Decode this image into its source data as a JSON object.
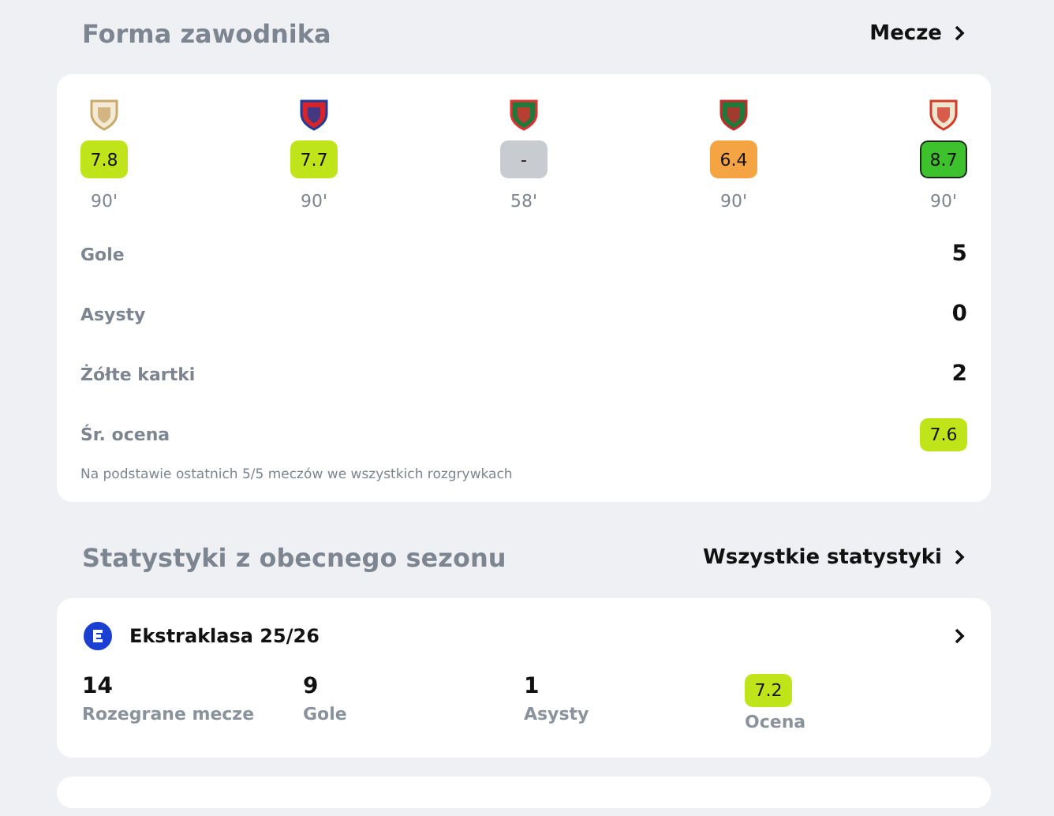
{
  "form_section": {
    "title": "Forma zawodnika",
    "link": "Mecze"
  },
  "matches": [
    {
      "rating": "7.8",
      "color": "#c0e41a",
      "highlighted": false,
      "minutes": "90'"
    },
    {
      "rating": "7.7",
      "color": "#c0e41a",
      "highlighted": false,
      "minutes": "90'"
    },
    {
      "rating": "-",
      "color": "#c8cbcf",
      "highlighted": false,
      "minutes": "58'"
    },
    {
      "rating": "6.4",
      "color": "#f4a443",
      "highlighted": false,
      "minutes": "90'"
    },
    {
      "rating": "8.7",
      "color": "#3dc12c",
      "highlighted": true,
      "minutes": "90'"
    }
  ],
  "form_stats": [
    {
      "kind": "number",
      "label": "Gole",
      "value": "5"
    },
    {
      "kind": "number",
      "label": "Asysty",
      "value": "0"
    },
    {
      "kind": "number",
      "label": "Żółte kartki",
      "value": "2"
    },
    {
      "kind": "rating",
      "label": "Śr. ocena",
      "value": "7.6",
      "color": "#c0e41a"
    }
  ],
  "form_note": "Na podstawie ostatnich 5/5 meczów we wszystkich rozgrywkach",
  "season_section": {
    "title": "Statystyki z obecnego sezonu",
    "link": "Wszystkie statystyki"
  },
  "competition": {
    "name": "Ekstraklasa 25/26",
    "stats": [
      {
        "kind": "number",
        "label": "Rozegrane mecze",
        "value": "14"
      },
      {
        "kind": "number",
        "label": "Gole",
        "value": "9"
      },
      {
        "kind": "number",
        "label": "Asysty",
        "value": "1"
      },
      {
        "kind": "rating",
        "label": "Ocena",
        "value": "7.2",
        "color": "#c0e41a"
      }
    ]
  }
}
